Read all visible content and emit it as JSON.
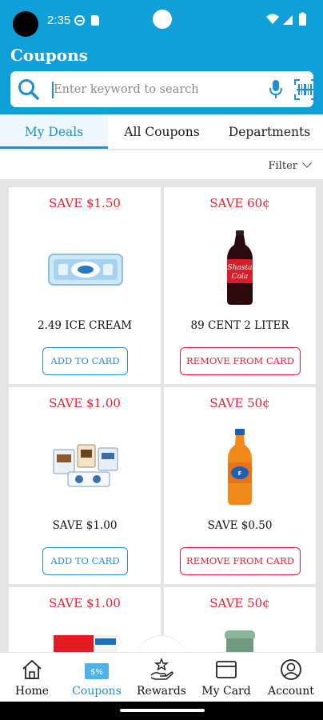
{
  "status_bar": {
    "time": "2:35"
  },
  "app": {
    "title": "Coupons"
  },
  "search": {
    "placeholder": "Enter keyword to search"
  },
  "tabs": [
    {
      "label": "My Deals",
      "active": true
    },
    {
      "label": "All Coupons",
      "active": false
    },
    {
      "label": "Departments",
      "active": false
    }
  ],
  "filter": {
    "label": "Filter"
  },
  "coupons": [
    {
      "save": "SAVE $1.50",
      "name": "2.49 ICE CREAM",
      "button": "ADD TO CARD",
      "image": "ice-cream-tub"
    },
    {
      "save": "SAVE 60¢",
      "name": "89 CENT 2 LITER",
      "button": "REMOVE FROM CARD",
      "image": "soda-bottle"
    },
    {
      "save": "SAVE $1.00",
      "name": "SAVE $1.00",
      "button": "ADD TO CARD",
      "image": "snack-packs"
    },
    {
      "save": "SAVE 50¢",
      "name": "SAVE $0.50",
      "button": "REMOVE FROM CARD",
      "image": "orange-soda-bottle"
    },
    {
      "save": "SAVE $1.00",
      "image": "toothpaste-box"
    },
    {
      "save": "SAVE 50¢",
      "image": "container-jar"
    }
  ],
  "bottom_nav": [
    {
      "label": "Home",
      "icon": "home-icon",
      "active": false
    },
    {
      "label": "Coupons",
      "icon": "coupon-icon",
      "active": true,
      "badge": "$%"
    },
    {
      "label": "Rewards",
      "icon": "rewards-icon",
      "active": false
    },
    {
      "label": "My Card",
      "icon": "card-icon",
      "active": false
    },
    {
      "label": "Account",
      "icon": "account-icon",
      "active": false
    }
  ],
  "colors": {
    "header": "#119fd8",
    "accent_blue": "#1e8fd0",
    "save_red": "#e8212e",
    "background": "#e3e3e3"
  }
}
